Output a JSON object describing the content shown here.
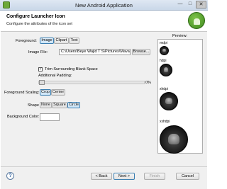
{
  "window": {
    "title": "New Android Application",
    "minimize": "—",
    "maximize": "□",
    "close": "✕"
  },
  "header": {
    "title": "Configure Launcher Icon",
    "subtitle": "Configure the attributes of the icon set"
  },
  "foreground": {
    "label": "Foreground:",
    "options": [
      "Image",
      "Clipart",
      "Text"
    ],
    "selected": "Image"
  },
  "image_file": {
    "label": "Image File:",
    "value": "C:\\Users\\Beye Wajid T S\\Pictures\\Mavar t",
    "browse_label": "Browse..."
  },
  "trim": {
    "label": "Trim Surrounding Blank Space",
    "checked": true,
    "check_mark": "✓"
  },
  "padding": {
    "label": "Additional Padding:",
    "value_text": "0%",
    "value": 0
  },
  "scaling": {
    "label": "Foreground Scaling:",
    "options": [
      "Crop",
      "Center"
    ],
    "selected": "Crop"
  },
  "shape": {
    "label": "Shape",
    "options": [
      "None",
      "Square",
      "Circle"
    ],
    "selected": "Circle"
  },
  "background": {
    "label": "Background Color:",
    "value": "#ffffff"
  },
  "preview": {
    "label": "Preview:",
    "densities": [
      "mdpi",
      "hdpi",
      "xhdpi",
      "xxhdpi"
    ]
  },
  "footer": {
    "help": "?",
    "back": "< Back",
    "next": "Next >",
    "finish": "Finish",
    "cancel": "Cancel"
  }
}
